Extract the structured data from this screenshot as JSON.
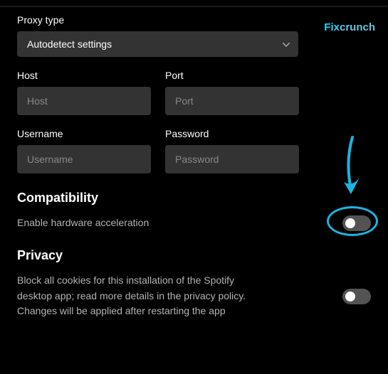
{
  "proxy": {
    "type_label": "Proxy type",
    "selected": "Autodetect settings",
    "host_label": "Host",
    "host_placeholder": "Host",
    "port_label": "Port",
    "port_placeholder": "Port",
    "username_label": "Username",
    "username_placeholder": "Username",
    "password_label": "Password",
    "password_placeholder": "Password"
  },
  "compatibility": {
    "title": "Compatibility",
    "hw_accel_label": "Enable hardware acceleration"
  },
  "privacy": {
    "title": "Privacy",
    "cookies_desc": "Block all cookies for this installation of the Spotify desktop app; read more details in the privacy policy. Changes will be applied after restarting the app"
  },
  "watermark": {
    "part1": "Fix",
    "part2": "crunch"
  }
}
